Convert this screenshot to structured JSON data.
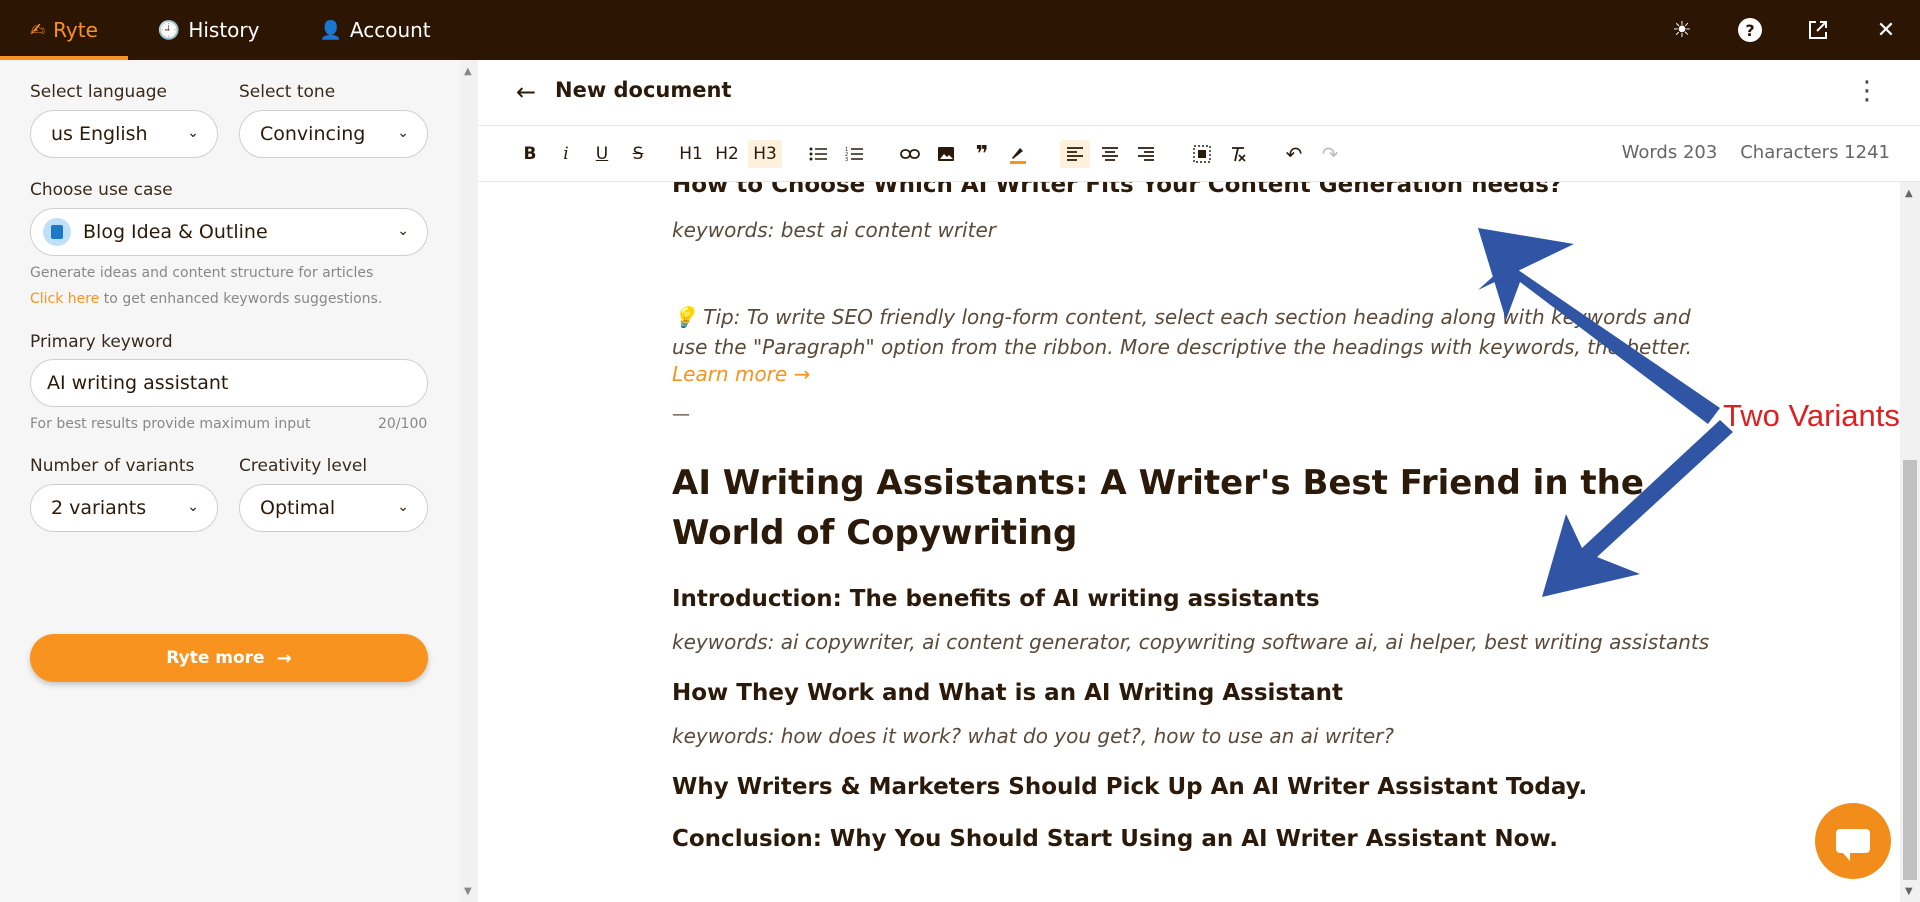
{
  "nav": {
    "tabs": [
      {
        "label": "Ryte",
        "icon": "quill-icon"
      },
      {
        "label": "History",
        "icon": "history-icon"
      },
      {
        "label": "Account",
        "icon": "user-icon"
      }
    ],
    "right_icons": [
      "sun-icon",
      "help-icon",
      "external-link-icon",
      "close-icon"
    ]
  },
  "sidebar": {
    "language_label": "Select language",
    "language_value": "us English",
    "tone_label": "Select tone",
    "tone_value": "Convincing",
    "usecase_label": "Choose use case",
    "usecase_value": "Blog Idea & Outline",
    "usecase_hint": "Generate ideas and content structure for articles",
    "keyword_link": "Click here",
    "keyword_hint_rest": " to get enhanced keywords suggestions.",
    "primary_keyword_label": "Primary keyword",
    "primary_keyword_value": "AI writing assistant",
    "keyword_help": "For best results provide maximum input",
    "keyword_count": "20/100",
    "variants_label": "Number of variants",
    "variants_value": "2 variants",
    "creativity_label": "Creativity level",
    "creativity_value": "Optimal",
    "cta_label": "Ryte more"
  },
  "document": {
    "title": "New document",
    "toolbar": {
      "bold": "B",
      "italic": "i",
      "underline": "U",
      "strike": "S",
      "h1": "H1",
      "h2": "H2",
      "h3": "H3"
    },
    "words": "Words 203",
    "characters": "Characters 1241",
    "content": {
      "heading_top": "How to Choose Which AI Writer Fits Your Content Generation needs?",
      "keywords_top": "keywords: best ai content writer",
      "tip": "Tip: To write SEO friendly long-form content, select each section heading along with keywords and use the \"Paragraph\" option from the ribbon. More descriptive the headings with keywords, the better.",
      "learn_more": "Learn more →",
      "dash": "—",
      "h1": "AI Writing Assistants: A Writer's Best Friend in the World of Copywriting",
      "sections": [
        {
          "heading": "Introduction: The benefits of AI writing assistants",
          "keywords": "keywords: ai copywriter, ai content generator, copywriting software ai, ai helper, best writing assistants"
        },
        {
          "heading": "How They Work and What is an AI Writing Assistant",
          "keywords": "keywords: how does it work? what do you get?, how to use an ai writer?"
        },
        {
          "heading": "Why Writers & Marketers Should Pick Up An AI Writer Assistant Today.",
          "keywords": ""
        },
        {
          "heading": "Conclusion: Why You Should Start Using an AI Writer Assistant Now.",
          "keywords": ""
        }
      ]
    }
  },
  "annotation": {
    "label": "Two Variants",
    "arrow_color": "#2f55a4",
    "label_color": "#e02020"
  },
  "colors": {
    "brand": "#f7931e",
    "topbar": "#2c1503"
  }
}
